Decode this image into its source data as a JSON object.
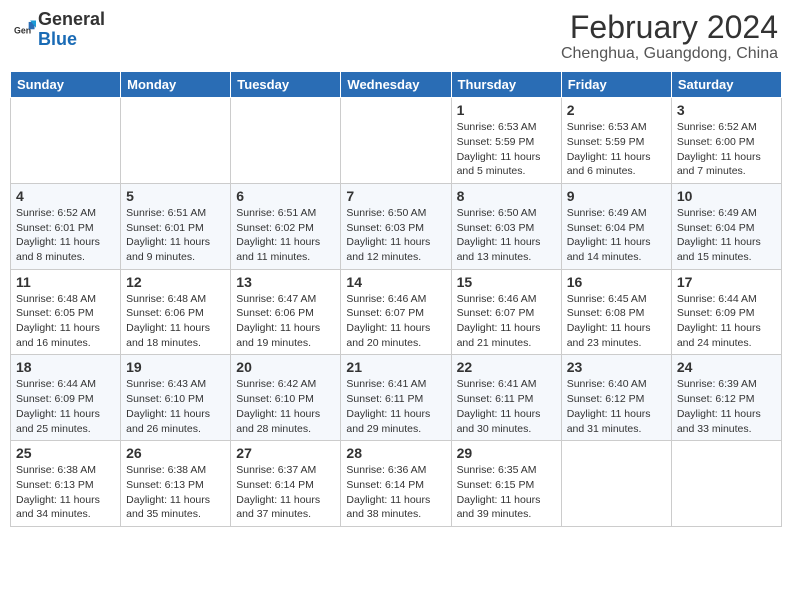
{
  "header": {
    "logo_general": "General",
    "logo_blue": "Blue",
    "month": "February 2024",
    "location": "Chenghua, Guangdong, China"
  },
  "days_of_week": [
    "Sunday",
    "Monday",
    "Tuesday",
    "Wednesday",
    "Thursday",
    "Friday",
    "Saturday"
  ],
  "weeks": [
    [
      {
        "day": "",
        "info": ""
      },
      {
        "day": "",
        "info": ""
      },
      {
        "day": "",
        "info": ""
      },
      {
        "day": "",
        "info": ""
      },
      {
        "day": "1",
        "info": "Sunrise: 6:53 AM\nSunset: 5:59 PM\nDaylight: 11 hours and 5 minutes."
      },
      {
        "day": "2",
        "info": "Sunrise: 6:53 AM\nSunset: 5:59 PM\nDaylight: 11 hours and 6 minutes."
      },
      {
        "day": "3",
        "info": "Sunrise: 6:52 AM\nSunset: 6:00 PM\nDaylight: 11 hours and 7 minutes."
      }
    ],
    [
      {
        "day": "4",
        "info": "Sunrise: 6:52 AM\nSunset: 6:01 PM\nDaylight: 11 hours and 8 minutes."
      },
      {
        "day": "5",
        "info": "Sunrise: 6:51 AM\nSunset: 6:01 PM\nDaylight: 11 hours and 9 minutes."
      },
      {
        "day": "6",
        "info": "Sunrise: 6:51 AM\nSunset: 6:02 PM\nDaylight: 11 hours and 11 minutes."
      },
      {
        "day": "7",
        "info": "Sunrise: 6:50 AM\nSunset: 6:03 PM\nDaylight: 11 hours and 12 minutes."
      },
      {
        "day": "8",
        "info": "Sunrise: 6:50 AM\nSunset: 6:03 PM\nDaylight: 11 hours and 13 minutes."
      },
      {
        "day": "9",
        "info": "Sunrise: 6:49 AM\nSunset: 6:04 PM\nDaylight: 11 hours and 14 minutes."
      },
      {
        "day": "10",
        "info": "Sunrise: 6:49 AM\nSunset: 6:04 PM\nDaylight: 11 hours and 15 minutes."
      }
    ],
    [
      {
        "day": "11",
        "info": "Sunrise: 6:48 AM\nSunset: 6:05 PM\nDaylight: 11 hours and 16 minutes."
      },
      {
        "day": "12",
        "info": "Sunrise: 6:48 AM\nSunset: 6:06 PM\nDaylight: 11 hours and 18 minutes."
      },
      {
        "day": "13",
        "info": "Sunrise: 6:47 AM\nSunset: 6:06 PM\nDaylight: 11 hours and 19 minutes."
      },
      {
        "day": "14",
        "info": "Sunrise: 6:46 AM\nSunset: 6:07 PM\nDaylight: 11 hours and 20 minutes."
      },
      {
        "day": "15",
        "info": "Sunrise: 6:46 AM\nSunset: 6:07 PM\nDaylight: 11 hours and 21 minutes."
      },
      {
        "day": "16",
        "info": "Sunrise: 6:45 AM\nSunset: 6:08 PM\nDaylight: 11 hours and 23 minutes."
      },
      {
        "day": "17",
        "info": "Sunrise: 6:44 AM\nSunset: 6:09 PM\nDaylight: 11 hours and 24 minutes."
      }
    ],
    [
      {
        "day": "18",
        "info": "Sunrise: 6:44 AM\nSunset: 6:09 PM\nDaylight: 11 hours and 25 minutes."
      },
      {
        "day": "19",
        "info": "Sunrise: 6:43 AM\nSunset: 6:10 PM\nDaylight: 11 hours and 26 minutes."
      },
      {
        "day": "20",
        "info": "Sunrise: 6:42 AM\nSunset: 6:10 PM\nDaylight: 11 hours and 28 minutes."
      },
      {
        "day": "21",
        "info": "Sunrise: 6:41 AM\nSunset: 6:11 PM\nDaylight: 11 hours and 29 minutes."
      },
      {
        "day": "22",
        "info": "Sunrise: 6:41 AM\nSunset: 6:11 PM\nDaylight: 11 hours and 30 minutes."
      },
      {
        "day": "23",
        "info": "Sunrise: 6:40 AM\nSunset: 6:12 PM\nDaylight: 11 hours and 31 minutes."
      },
      {
        "day": "24",
        "info": "Sunrise: 6:39 AM\nSunset: 6:12 PM\nDaylight: 11 hours and 33 minutes."
      }
    ],
    [
      {
        "day": "25",
        "info": "Sunrise: 6:38 AM\nSunset: 6:13 PM\nDaylight: 11 hours and 34 minutes."
      },
      {
        "day": "26",
        "info": "Sunrise: 6:38 AM\nSunset: 6:13 PM\nDaylight: 11 hours and 35 minutes."
      },
      {
        "day": "27",
        "info": "Sunrise: 6:37 AM\nSunset: 6:14 PM\nDaylight: 11 hours and 37 minutes."
      },
      {
        "day": "28",
        "info": "Sunrise: 6:36 AM\nSunset: 6:14 PM\nDaylight: 11 hours and 38 minutes."
      },
      {
        "day": "29",
        "info": "Sunrise: 6:35 AM\nSunset: 6:15 PM\nDaylight: 11 hours and 39 minutes."
      },
      {
        "day": "",
        "info": ""
      },
      {
        "day": "",
        "info": ""
      }
    ]
  ]
}
